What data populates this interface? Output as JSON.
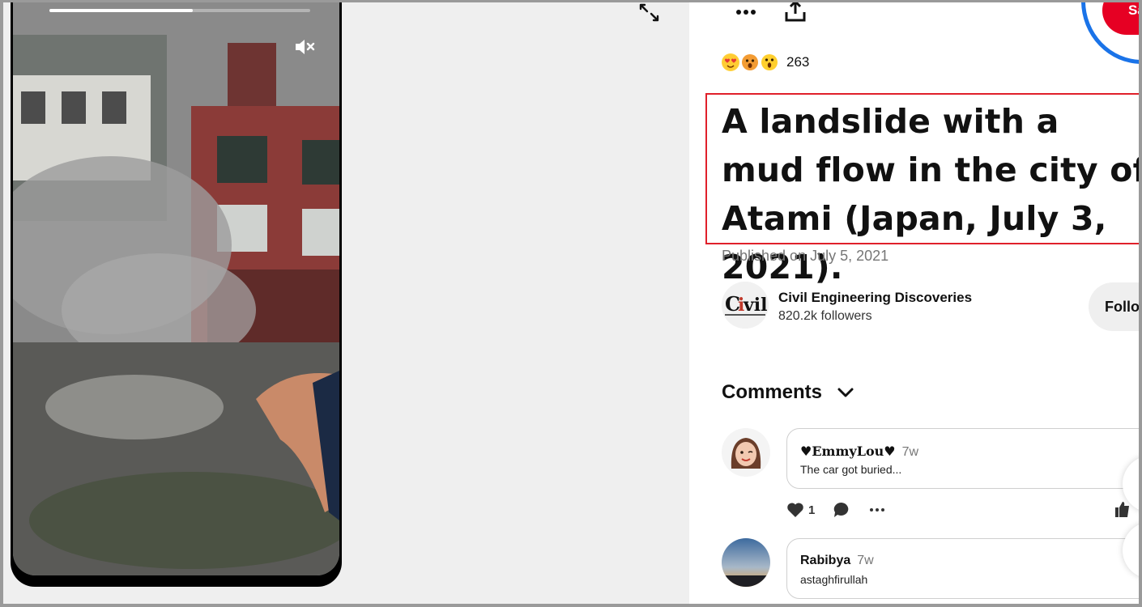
{
  "video": {
    "progress_percent": 55,
    "mute_icon": "volume-mute-icon",
    "expand_icon": "expand-arrows-icon"
  },
  "toolbar": {
    "more_icon": "more-options-icon",
    "share_icon": "share-upload-icon",
    "save_label": "Sav"
  },
  "reactions": {
    "icons": [
      "heart-eyes-emoji",
      "surprised-emoji",
      "wow-emoji"
    ],
    "count": "263"
  },
  "pin": {
    "title": "A landslide with a mud flow in the city of Atami (Japan, July 3, 2021).",
    "published": "Published on July 5, 2021"
  },
  "creator": {
    "name": "Civil Engineering Discoveries",
    "followers": "820.2k followers",
    "follow_label": "Follo"
  },
  "comments": {
    "heading": "Comments",
    "items": [
      {
        "author": "♥EmmyLou♥",
        "age": "7w",
        "text": "The car got buried...",
        "likes": "1"
      },
      {
        "author": "Rabibya",
        "age": "7w",
        "text": "astaghfirullah"
      }
    ]
  },
  "colors": {
    "save_red": "#e60023",
    "highlight_red": "#e0202a",
    "focus_blue": "#1a73e8"
  }
}
